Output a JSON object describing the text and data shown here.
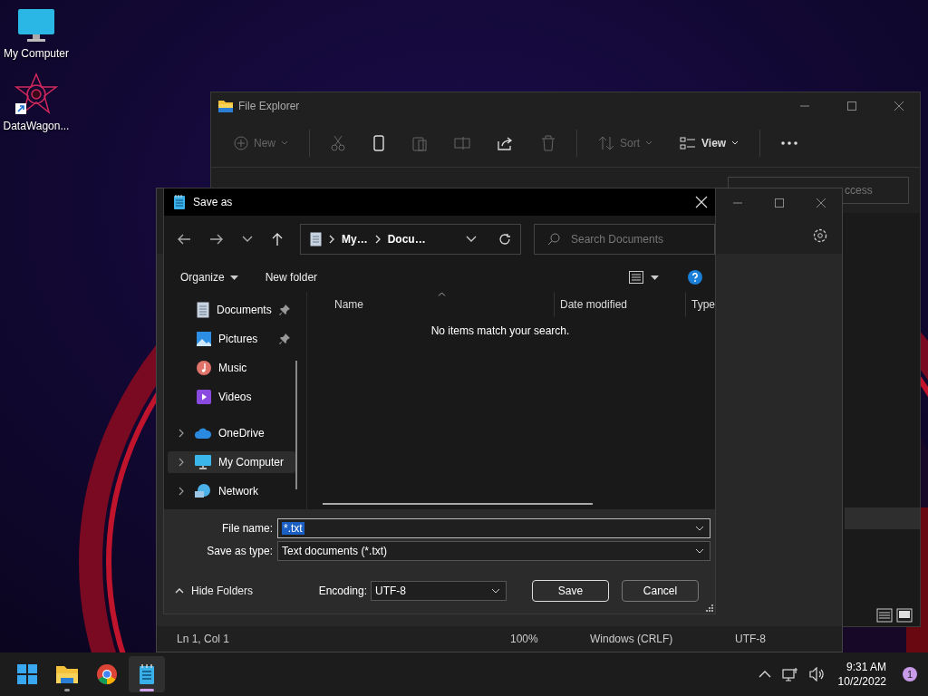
{
  "desktop": {
    "icons": [
      {
        "label": "My Computer",
        "kind": "computer"
      },
      {
        "label": "DataWagon...",
        "kind": "app"
      }
    ]
  },
  "explorer": {
    "title": "File Explorer",
    "toolbar": [
      {
        "kind": "new",
        "label": "New",
        "disabled": true
      },
      {
        "kind": "cut",
        "disabled": true
      },
      {
        "kind": "copy",
        "disabled": false
      },
      {
        "kind": "paste",
        "disabled": true
      },
      {
        "kind": "rename",
        "disabled": true
      },
      {
        "kind": "share",
        "disabled": false
      },
      {
        "kind": "delete",
        "disabled": true
      },
      {
        "kind": "sort",
        "label": "Sort",
        "disabled": true
      },
      {
        "kind": "view",
        "label": "View",
        "disabled": false
      },
      {
        "kind": "more",
        "disabled": false
      }
    ],
    "search": {
      "placeholder": "ccess"
    }
  },
  "notepad": {
    "status_bar": [
      "Ln 1, Col 1",
      "100%",
      "Windows (CRLF)",
      "UTF-8"
    ]
  },
  "dialog": {
    "title": "Save as",
    "breadcrumb": [
      "My…",
      "Docu…"
    ],
    "search": {
      "placeholder": "Search Documents"
    },
    "organize": "Organize",
    "new_folder": "New folder",
    "quick_items": [
      {
        "label": "Documents",
        "kind": "documents",
        "pinned": true,
        "selected": false
      },
      {
        "label": "Pictures",
        "kind": "pictures",
        "pinned": true,
        "selected": false
      },
      {
        "label": "Music",
        "kind": "music",
        "pinned": false,
        "selected": false
      },
      {
        "label": "Videos",
        "kind": "videos",
        "pinned": false,
        "selected": false
      }
    ],
    "roots": [
      {
        "label": "OneDrive",
        "kind": "cloud",
        "selected": false
      },
      {
        "label": "My Computer",
        "kind": "computer",
        "selected": true
      },
      {
        "label": "Network",
        "kind": "network",
        "selected": false
      }
    ],
    "columns": [
      "Name",
      "Date modified",
      "Type"
    ],
    "empty_message": "No items match your search.",
    "file_name": {
      "label": "File name:",
      "value": "*.txt"
    },
    "save_type": {
      "label": "Save as type:",
      "value": "Text documents (*.txt)"
    },
    "hide_folders": "Hide Folders",
    "encoding": {
      "label": "Encoding:",
      "value": "UTF-8"
    },
    "buttons": [
      {
        "label": "Save",
        "kind": "default"
      },
      {
        "label": "Cancel",
        "kind": "normal"
      }
    ]
  },
  "taskbar": {
    "apps": [
      {
        "kind": "start",
        "running": false,
        "selected": false
      },
      {
        "kind": "folder",
        "running": true,
        "selected": false
      },
      {
        "kind": "browser",
        "running": false,
        "selected": false
      },
      {
        "kind": "notepad",
        "running": true,
        "selected": true
      }
    ],
    "time": "9:31 AM",
    "date": "10/2/2022",
    "notifications": "1"
  }
}
